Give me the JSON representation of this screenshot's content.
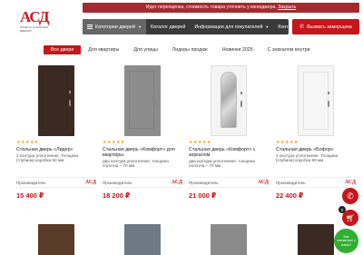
{
  "logo": {
    "mark": "АСД",
    "tagline": "АЛЬЯНС СТАЛЬНЫХ ДВЕРЕЙ"
  },
  "notice": {
    "text": "Идет переоценка, стоимость товара уточнить у менеджера.",
    "link": "Закрыть"
  },
  "nav": {
    "catalog": "Категории дверей",
    "catalog_doors": "Каталог дверей",
    "info": "Информация для покупателей",
    "contacts": "Контакты"
  },
  "call_button": "Вызвать замерщика",
  "filters": [
    "Все двери",
    "Для квартиры",
    "Для улицы",
    "Лидеры продаж",
    "Новинки 2025",
    "С зеркалом внутри"
  ],
  "products": [
    {
      "stars": "★★★★★",
      "title": "Стальная дверь «Лидер»",
      "desc": "2 контура уплотнения. Толщина (глубина) коробка 94 мм.",
      "maker_label": "Производитель",
      "maker": "АСД",
      "price": "15 400 ₽",
      "door_color": "#3b2a22",
      "inner_color": "#3a2b23"
    },
    {
      "stars": "★★★★★",
      "title": "Стальная дверь «Комфорт» для квартиры",
      "desc": "два контура уплотнения, толщина полотна – 70 мм",
      "maker_label": "Производитель",
      "maker": "АСД",
      "price": "18 200 ₽",
      "door_color": "#8c8c8c",
      "inner_color": "#7d7d7d"
    },
    {
      "stars": "★★★★★",
      "title": "Стальная дверь «Комфорт» с зеркалом",
      "desc": "два контура уплотнения, толщина полотна – 70 мм",
      "maker_label": "Производитель",
      "maker": "АСД",
      "price": "21 000 ₽",
      "door_color": "#f4f4f4",
      "inner_color": "#ffffff"
    },
    {
      "stars": "★★★★★",
      "title": "Стальная дверь «Бофор»",
      "desc": "2 контура уплотнения. Толщина (глубина) коробка 90 мм",
      "maker_label": "Производитель",
      "maker": "АСД",
      "price": "22 400 ₽",
      "door_color": "#f6f6f6",
      "inner_color": "#ffffff"
    }
  ],
  "row2_colors": [
    "#5a3a28",
    "#6d7a86",
    "#8a8a8a",
    "#3a2a22"
  ],
  "floating": {
    "cart_count": "0",
    "chat_label": "Как связаться с нами?"
  }
}
